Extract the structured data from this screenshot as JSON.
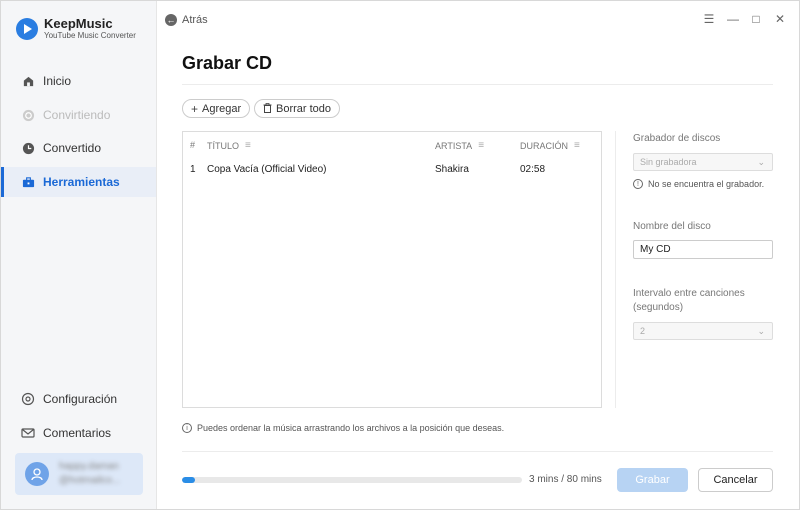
{
  "app": {
    "name": "KeepMusic",
    "subtitle": "YouTube Music Converter"
  },
  "sidebar": {
    "items": [
      {
        "label": "Inicio",
        "icon": "home-icon"
      },
      {
        "label": "Convirtiendo",
        "icon": "sync-icon"
      },
      {
        "label": "Convertido",
        "icon": "clock-icon"
      },
      {
        "label": "Herramientas",
        "icon": "toolbox-icon"
      }
    ],
    "bottom_items": [
      {
        "label": "Configuración",
        "icon": "gear-icon"
      },
      {
        "label": "Comentarios",
        "icon": "mail-icon"
      }
    ],
    "user": {
      "line1": "happy.daman",
      "line2": "@hotmailco..."
    }
  },
  "titlebar": {
    "back_label": "Atrás"
  },
  "page": {
    "title": "Grabar CD"
  },
  "toolbar": {
    "add_label": "Agregar",
    "clear_label": "Borrar todo"
  },
  "table": {
    "headers": {
      "num": "#",
      "title": "TÍTULO",
      "artist": "ARTISTA",
      "duration": "DURACIÓN"
    },
    "rows": [
      {
        "num": "1",
        "title": "Copa Vacía (Official Video)",
        "artist": "Shakira",
        "duration": "02:58"
      }
    ]
  },
  "panel": {
    "burner_label": "Grabador de discos",
    "burner_value": "Sin grabadora",
    "burner_warning": "No se encuentra el grabador.",
    "disc_name_label": "Nombre del disco",
    "disc_name_value": "My CD",
    "interval_label_1": "Intervalo entre canciones",
    "interval_label_2": "(segundos)",
    "interval_value": "2"
  },
  "hint": "Puedes ordenar la música arrastrando los archivos a la posición que deseas.",
  "footer": {
    "progress_fraction": 0.0375,
    "progress_text": "3 mins / 80 mins",
    "burn_label": "Grabar",
    "cancel_label": "Cancelar"
  },
  "colors": {
    "accent": "#1b69d6",
    "primary_disabled": "#b7d3f3",
    "progress": "#2a8de6"
  }
}
